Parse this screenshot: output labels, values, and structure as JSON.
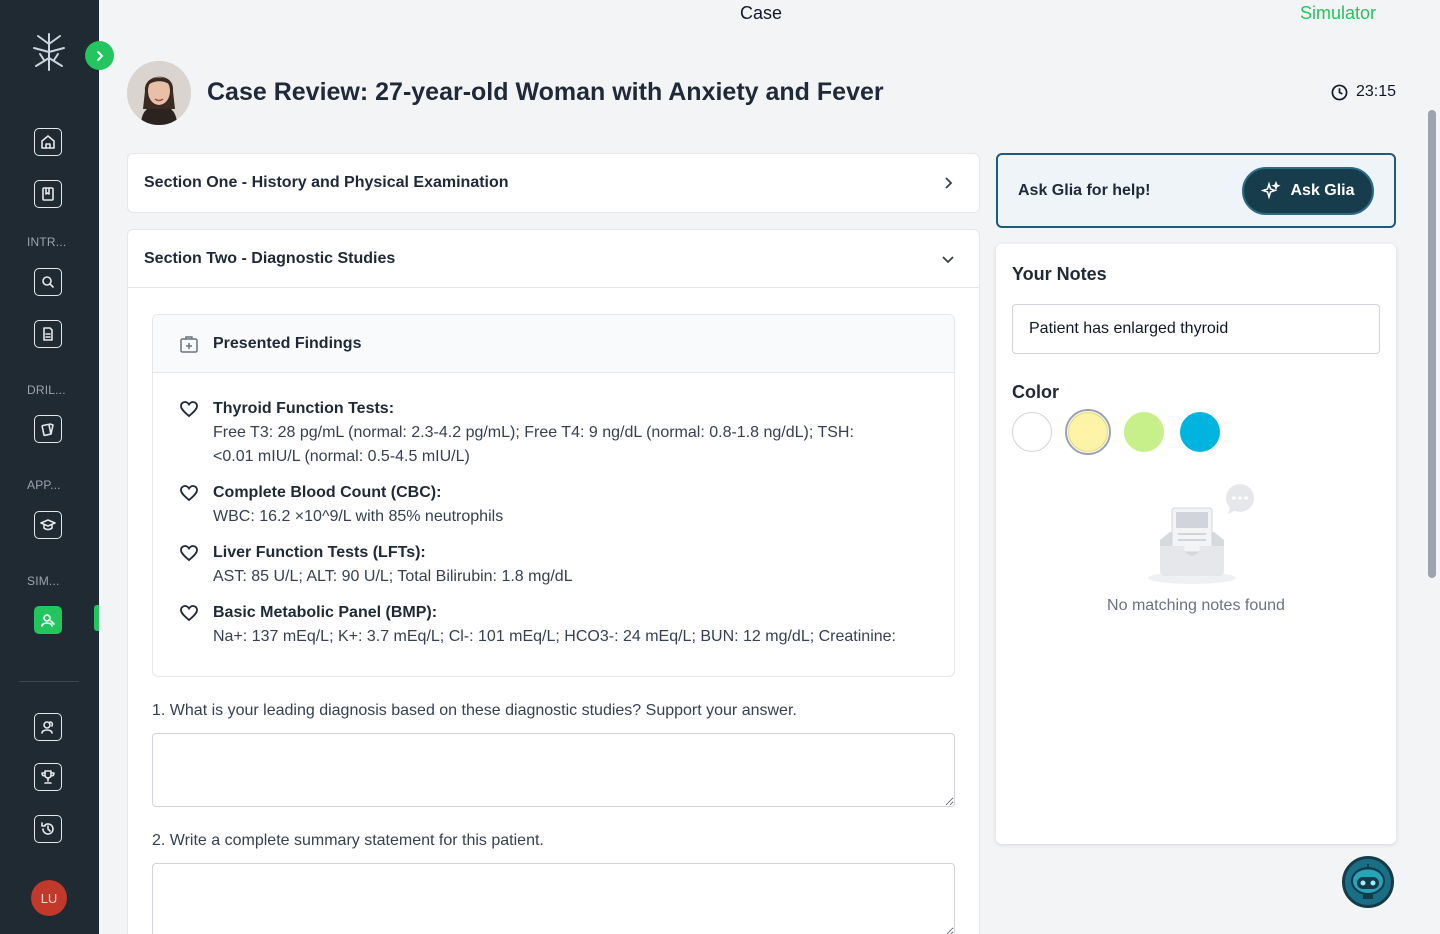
{
  "topbar": {
    "center_title": "Case",
    "right_link": "Simulator"
  },
  "sidebar": {
    "sections": [
      {
        "label": "INTR..."
      },
      {
        "label": "DRIL..."
      },
      {
        "label": "APP..."
      },
      {
        "label": "SIM..."
      }
    ],
    "user_initials": "LU",
    "icons": [
      "home-icon",
      "book-icon",
      "search-icon",
      "document-icon",
      "cards-icon",
      "graduation-cap-icon",
      "user-simulator-icon",
      "users-icon",
      "trophy-icon",
      "history-icon"
    ]
  },
  "case": {
    "title": "Case Review: 27-year-old Woman with Anxiety and Fever",
    "timer": "23:15"
  },
  "section_one": {
    "title": "Section One - History and Physical Examination"
  },
  "section_two": {
    "title": "Section Two - Diagnostic Studies",
    "findings_title": "Presented Findings",
    "findings": [
      {
        "title": "Thyroid Function Tests:",
        "line1": "Free T3: 28 pg/mL (normal: 2.3-4.2 pg/mL); Free T4: 9 ng/dL (normal: 0.8-1.8 ng/dL); TSH:",
        "line2": "<0.01 mIU/L (normal: 0.5-4.5 mIU/L)"
      },
      {
        "title": "Complete Blood Count (CBC):",
        "line1": "WBC: 16.2 ×10^9/L with 85% neutrophils",
        "line2": ""
      },
      {
        "title": "Liver Function Tests (LFTs):",
        "line1": "AST: 85 U/L; ALT: 90 U/L; Total Bilirubin: 1.8 mg/dL",
        "line2": ""
      },
      {
        "title": "Basic Metabolic Panel (BMP):",
        "line1": "Na+: 137 mEq/L; K+: 3.7 mEq/L; Cl-: 101 mEq/L; HCO3-: 24 mEq/L; BUN: 12 mg/dL; Creatinine:",
        "line2": ""
      }
    ],
    "questions": [
      {
        "text": "1. What is your leading diagnosis based on these diagnostic studies? Support your answer.",
        "answer": ""
      },
      {
        "text": "2. Write a complete summary statement for this patient.",
        "answer": ""
      }
    ]
  },
  "glia": {
    "prompt": "Ask Glia for help!",
    "button_label": "Ask Glia"
  },
  "notes": {
    "title": "Your Notes",
    "input_value": "Patient has enlarged thyroid",
    "color_title": "Color",
    "colors": [
      "#ffffff",
      "#fef3a6",
      "#c7f08a",
      "#00b4e0"
    ],
    "selected_color_index": 1,
    "empty_text": "No matching notes found"
  }
}
